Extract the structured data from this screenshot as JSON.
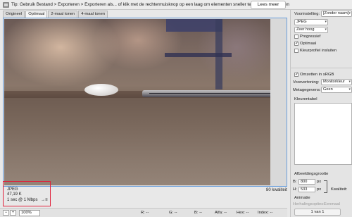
{
  "tipbar": {
    "text": "Tip: Gebruik Bestand > Exporteren > Exporteren als... of klik met de rechtermuisknop op een laag om elementen sneller te kunnen exporteren",
    "learn_more": "Lees meer"
  },
  "tabs": [
    "Origineel",
    "Optimaal",
    "2-maal tonen",
    "4-maal tonen"
  ],
  "active_tab": 1,
  "canvas": {
    "info": {
      "format": "JPEG",
      "size": "47,19 K",
      "speed": "1 sec @ 1 Mbps",
      "speed_menu": "→≡"
    },
    "quality": "80 kwaliteit"
  },
  "bottombar": {
    "zoom_minus": "−",
    "zoom_plus": "+",
    "zoom": "100%",
    "r": "R: --",
    "g": "G: --",
    "b": "B: --",
    "alpha": "Alfa: --",
    "hex": "Hex: --",
    "index": "Index: --"
  },
  "panel": {
    "preset_label": "Voorinstelling:",
    "preset_value": "[Zonder naam]",
    "format": "JPEG",
    "quality_level": "Zeer hoog",
    "progressive": "Progressief",
    "progressive_checked": false,
    "optimized": "Optimaal",
    "optimized_checked": true,
    "embed_profile": "Kleurprofiel insluiten",
    "embed_profile_checked": false,
    "convert_srgb": "Omzetten in sRGB",
    "convert_srgb_checked": true,
    "preview_label": "Voorvertoning:",
    "preview_value": "Monitorkleur",
    "metadata_label": "Metagegevens:",
    "metadata_value": "Geen",
    "color_table": "Kleurentabel",
    "image_size": "Afbeeldingsgrootte",
    "width_label": "B:",
    "width_value": "800",
    "height_label": "H:",
    "height_value": "533",
    "unit": "px",
    "quality_label": "Kwaliteit:",
    "animation": "Animatie",
    "repeat_label": "Herhalingsopties:",
    "repeat_value": "Eenmaal",
    "page": "1 van 1"
  }
}
